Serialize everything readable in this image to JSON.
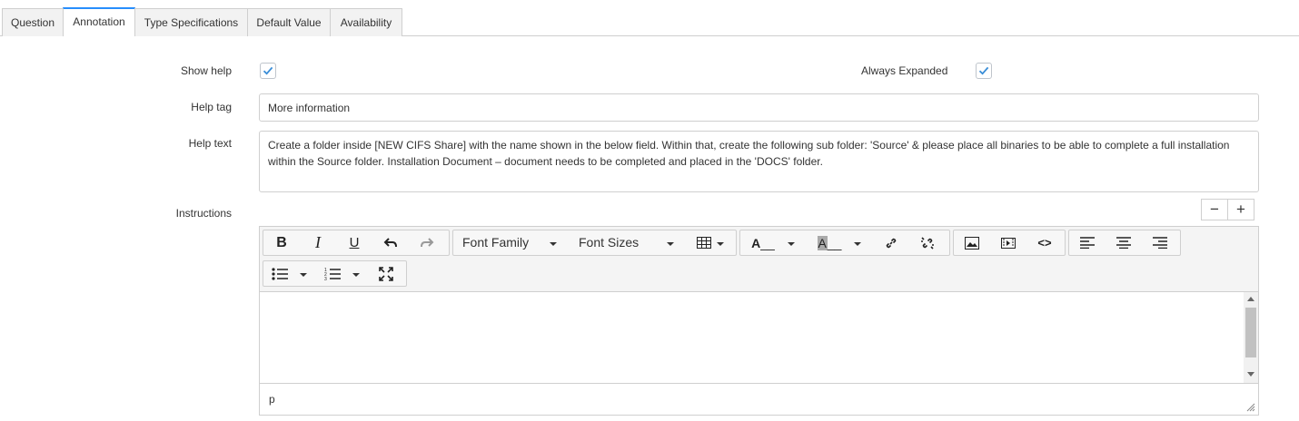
{
  "tabs": [
    {
      "label": "Question",
      "active": false
    },
    {
      "label": "Annotation",
      "active": true
    },
    {
      "label": "Type Specifications",
      "active": false
    },
    {
      "label": "Default Value",
      "active": false
    },
    {
      "label": "Availability",
      "active": false
    }
  ],
  "form": {
    "show_help_label": "Show help",
    "show_help_checked": true,
    "always_expanded_label": "Always Expanded",
    "always_expanded_checked": true,
    "help_tag_label": "Help tag",
    "help_tag_value": "More information",
    "help_text_label": "Help text",
    "help_text_value": "Create a folder inside [NEW CIFS Share] with the name shown in the below field. Within that, create the following sub folder: 'Source' & please place all binaries to be able to complete a full installation within the Source folder.  Installation Document – document needs to be completed and placed in the 'DOCS' folder.",
    "instructions_label": "Instructions"
  },
  "editor": {
    "font_family_label": "Font Family",
    "font_sizes_label": "Font Sizes",
    "status_path": "p",
    "shrink_label": "−",
    "expand_label": "+"
  },
  "colors": {
    "accent": "#278efc",
    "check": "#3b8ed8"
  }
}
